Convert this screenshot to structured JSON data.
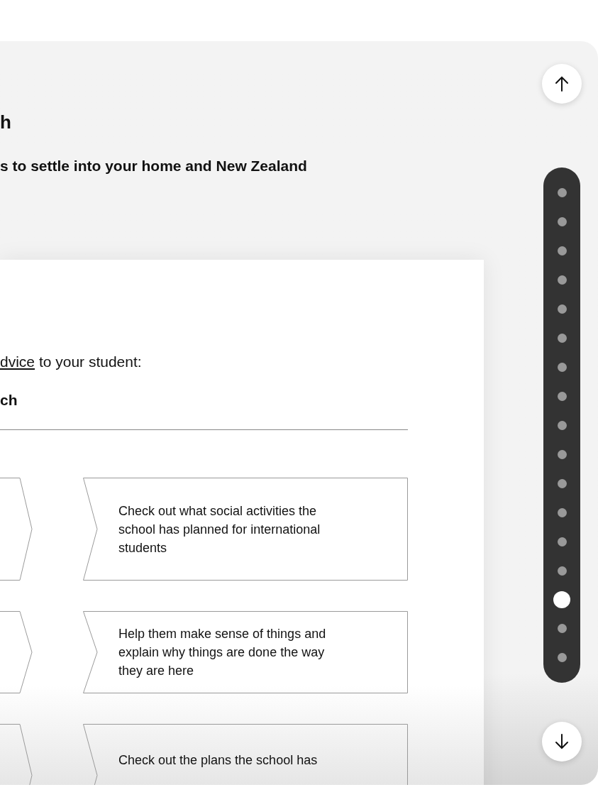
{
  "heading": "h",
  "subheading": "s to settle into your home and New Zealand",
  "intro": {
    "link": "dvice",
    "text": "to your student:"
  },
  "section_heading": "ch",
  "steps": [
    {
      "text": "Check out what social activities the school has planned for international students"
    },
    {
      "text": "Help them make sense of things and explain why things are done the way they are here"
    },
    {
      "text": "Check out the plans the school has"
    }
  ],
  "nav_dots": [
    {
      "selected": false
    },
    {
      "selected": false
    },
    {
      "selected": false
    },
    {
      "selected": false
    },
    {
      "selected": false
    },
    {
      "selected": false
    },
    {
      "selected": false
    },
    {
      "selected": false
    },
    {
      "selected": false
    },
    {
      "selected": false
    },
    {
      "selected": false
    },
    {
      "selected": false
    },
    {
      "selected": false
    },
    {
      "selected": false
    },
    {
      "selected": true
    },
    {
      "selected": false
    },
    {
      "selected": false
    }
  ]
}
